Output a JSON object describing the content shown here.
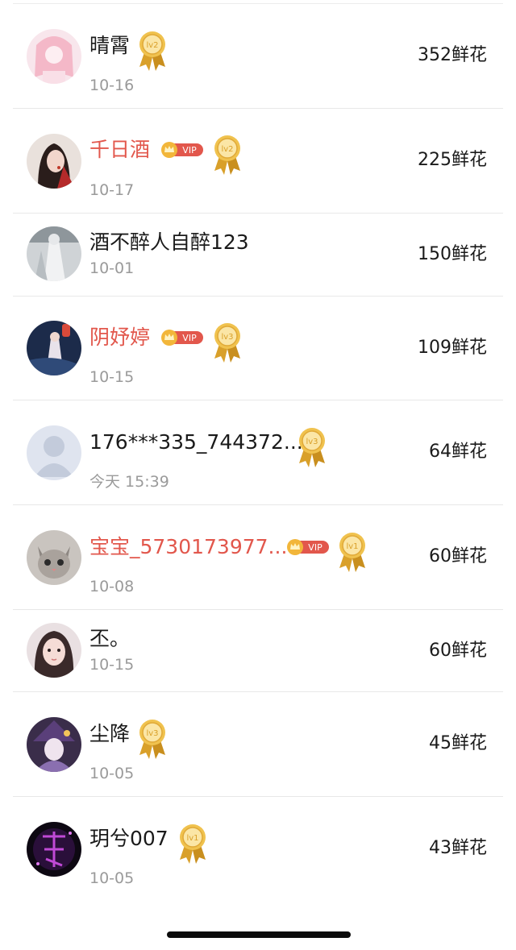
{
  "list": [
    {
      "name": "晴霄",
      "date": "10-16",
      "flowers": "352鲜花",
      "vip": false,
      "level": "lv2",
      "avatar": "pink-anime-girl"
    },
    {
      "name": "千日酒",
      "date": "10-17",
      "flowers": "225鲜花",
      "vip": true,
      "vip_label": "VIP",
      "level": "lv2",
      "avatar": "dark-hair-portrait"
    },
    {
      "name": "酒不醉人自醉123",
      "date": "10-01",
      "flowers": "150鲜花",
      "vip": false,
      "level": "",
      "avatar": "white-robed-figure"
    },
    {
      "name": "阴妤婷",
      "date": "10-15",
      "flowers": "109鲜花",
      "vip": true,
      "vip_label": "VIP",
      "level": "lv3",
      "avatar": "lantern-night-scene"
    },
    {
      "name": "176***335_744372...",
      "date": "今天 15:39",
      "flowers": "64鲜花",
      "vip": false,
      "level": "lv3",
      "avatar": "default-person"
    },
    {
      "name": "宝宝_5730173977...",
      "date": "10-08",
      "flowers": "60鲜花",
      "vip": true,
      "vip_label": "VIP",
      "level": "lv1",
      "avatar": "kitten"
    },
    {
      "name": "丕。",
      "date": "10-15",
      "flowers": "60鲜花",
      "vip": false,
      "level": "",
      "avatar": "girl-portrait"
    },
    {
      "name": "尘降",
      "date": "10-05",
      "flowers": "45鲜花",
      "vip": false,
      "level": "lv3",
      "avatar": "anime-witch"
    },
    {
      "name": "玥兮007",
      "date": "10-05",
      "flowers": "43鲜花",
      "vip": false,
      "level": "lv1",
      "avatar": "purple-calligraphy"
    }
  ],
  "colors": {
    "vip_name": "#e2574c",
    "text": "#1a1a1a",
    "date": "#9a9a9a",
    "medal_gold": "#e8b33c",
    "vip_badge": "#e2574c"
  }
}
